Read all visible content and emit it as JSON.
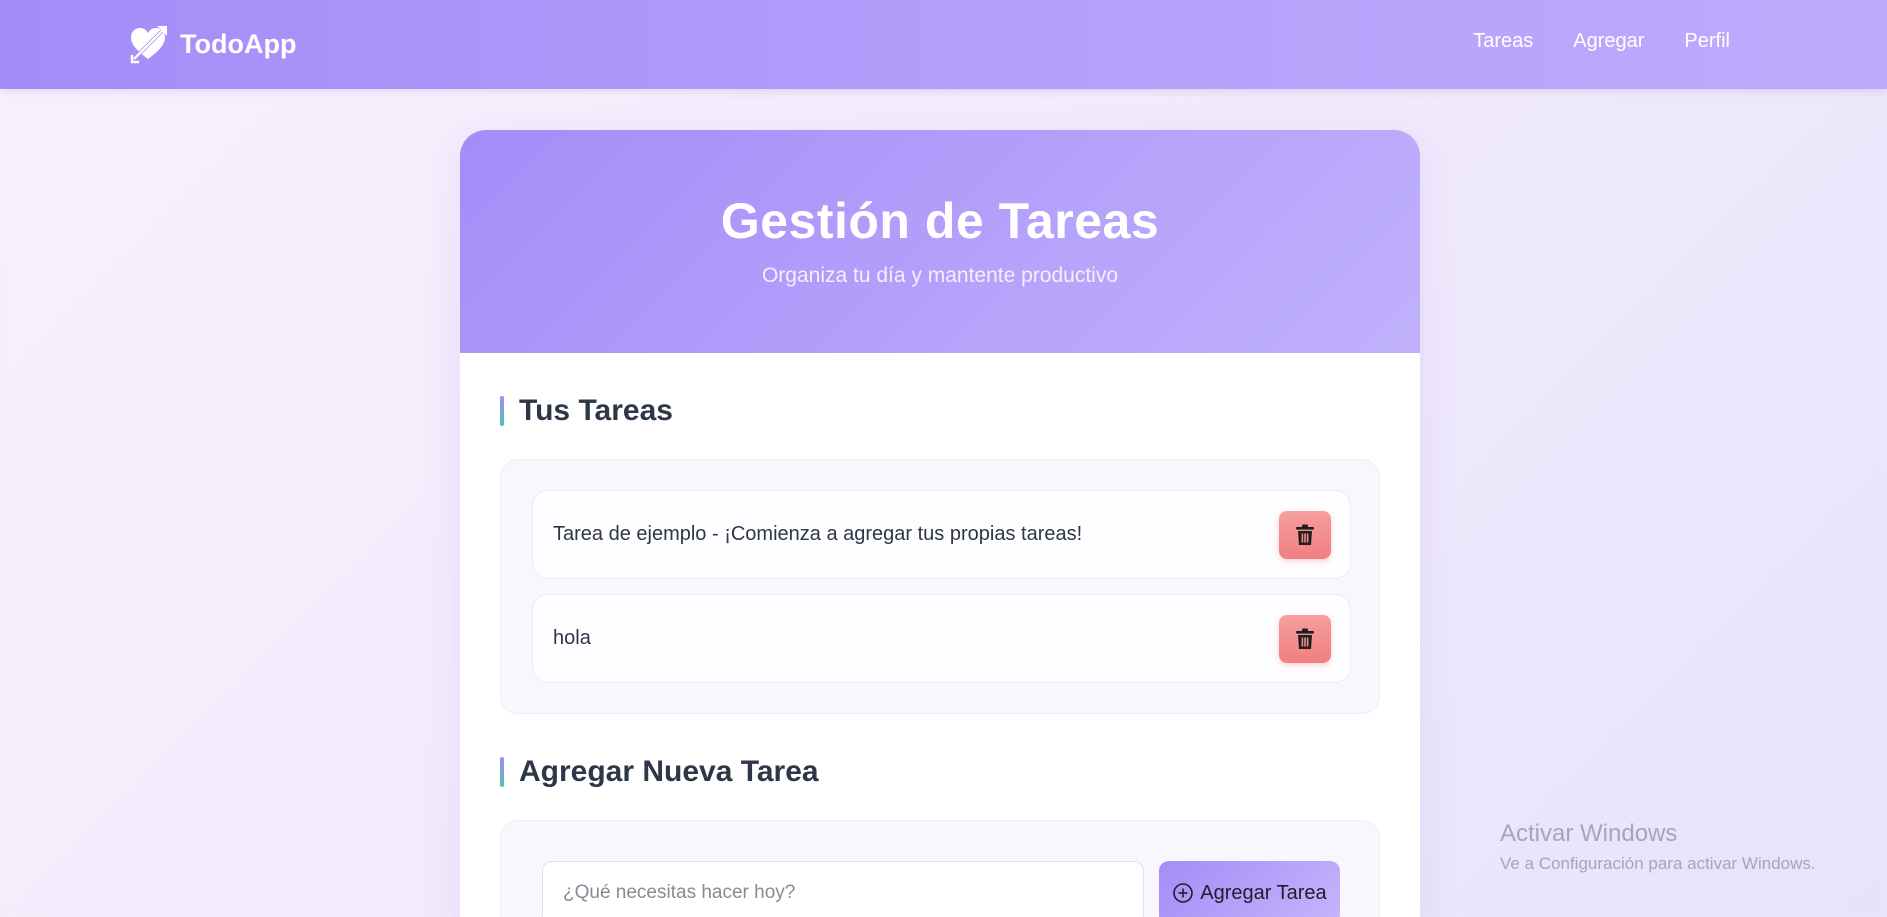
{
  "navbar": {
    "brand": "TodoApp",
    "brand_icon": "heart-arrow-icon",
    "links": [
      "Tareas",
      "Agregar",
      "Perfil"
    ]
  },
  "hero": {
    "title": "Gestión de Tareas",
    "subtitle": "Organiza tu día y mantente productivo"
  },
  "tasks_section": {
    "heading": "Tus Tareas",
    "items": [
      {
        "text": "Tarea de ejemplo - ¡Comienza a agregar tus propias tareas!",
        "action_icon": "trash-icon"
      },
      {
        "text": "hola",
        "action_icon": "trash-icon"
      }
    ]
  },
  "add_section": {
    "heading": "Agregar Nueva Tarea",
    "input_value": "",
    "input_placeholder": "¿Qué necesitas hacer hoy?",
    "button_label": "Agregar Tarea",
    "button_icon": "plus-circle-icon"
  },
  "watermark": {
    "title": "Activar Windows",
    "subtitle": "Ve a Configuración para activar Windows."
  },
  "colors": {
    "primary": "#a48cf7",
    "primary_light": "#bcabfc",
    "danger": "#f07f80",
    "accent_teal": "#4fc5b4",
    "text": "#2d3748"
  }
}
